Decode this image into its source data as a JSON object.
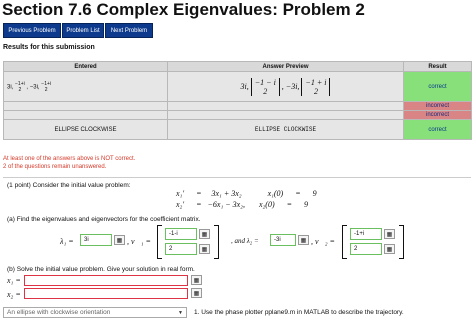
{
  "page": {
    "title": "Section 7.6 Complex Eigenvalues: Problem 2"
  },
  "nav": {
    "prev": "Previous Problem",
    "list": "Problem List",
    "next": "Next Problem"
  },
  "results": {
    "heading": "Results for this submission",
    "headers": {
      "entered": "Entered",
      "preview": "Answer Preview",
      "result": "Result"
    },
    "row1": {
      "entered_a": "3i,",
      "entered_b": "−1+i",
      "entered_c": "2",
      "entered_d": ", −3i,",
      "entered_e": "−1+i",
      "entered_f": "2",
      "prev_a": "3i,",
      "prev_b": "−1 − i",
      "prev_c": "2",
      "prev_d": ", −3i,",
      "prev_e": "−1 + i",
      "prev_f": "2",
      "result": "correct"
    },
    "row2_result": "incorrect",
    "row3_result": "incorrect",
    "row4": {
      "entered": "ELLIPSE CLOCKWISE",
      "preview": "ELLIPSE CLOCKWISE",
      "result": "correct"
    }
  },
  "warnings": {
    "line1": "At least one of the answers above is NOT correct.",
    "line2": "2 of the questions remain unanswered."
  },
  "problem": {
    "intro": "(1 point) Consider the initial value problem:",
    "eq1_lhs": "x₁′",
    "eq1_eq": "=",
    "eq1_rhs": "3x₁ + 3x₂",
    "eq1_ic": "x₁(0)",
    "eq1_ic_eq": "=",
    "eq1_ic_val": "9",
    "eq2_lhs": "x₂′",
    "eq2_eq": "=",
    "eq2_rhs": "−6x₁ − 3x₂",
    "eq2_comma": ",",
    "eq2_ic": "x₂(0)",
    "eq2_ic_eq": "=",
    "eq2_ic_val": "9",
    "part_a": "(a) Find the eigenvalues and eigenvectors for the coefficient matrix.",
    "lambda1_label": "λ₁ =",
    "lambda1_value": "3i",
    "v1_label": ", v⃗₁ =",
    "v1_top": "-1-i",
    "v1_bottom": "2",
    "and_label": ", and λ₂ =",
    "lambda2_value": "-3i",
    "v2_label": ", v⃗₂ =",
    "v2_top": "-1+i",
    "v2_bottom": "2",
    "part_b": "(b) Solve the initial value problem. Give your solution in real form.",
    "x1_label": "x₁ =",
    "x2_label": "x₂ =",
    "x1_value": "",
    "x2_value": "",
    "kbd_icon": "keyboard-icon",
    "select_value": "An ellipse with clockwise orientation",
    "part_c": "1. Use the phase plotter pplane9.m in MATLAB to describe the trajectory."
  },
  "colors": {
    "nav": "#0d3a8c",
    "correct": "#88e07a",
    "incorrect": "#d98585",
    "warn": "#d43a2a"
  }
}
